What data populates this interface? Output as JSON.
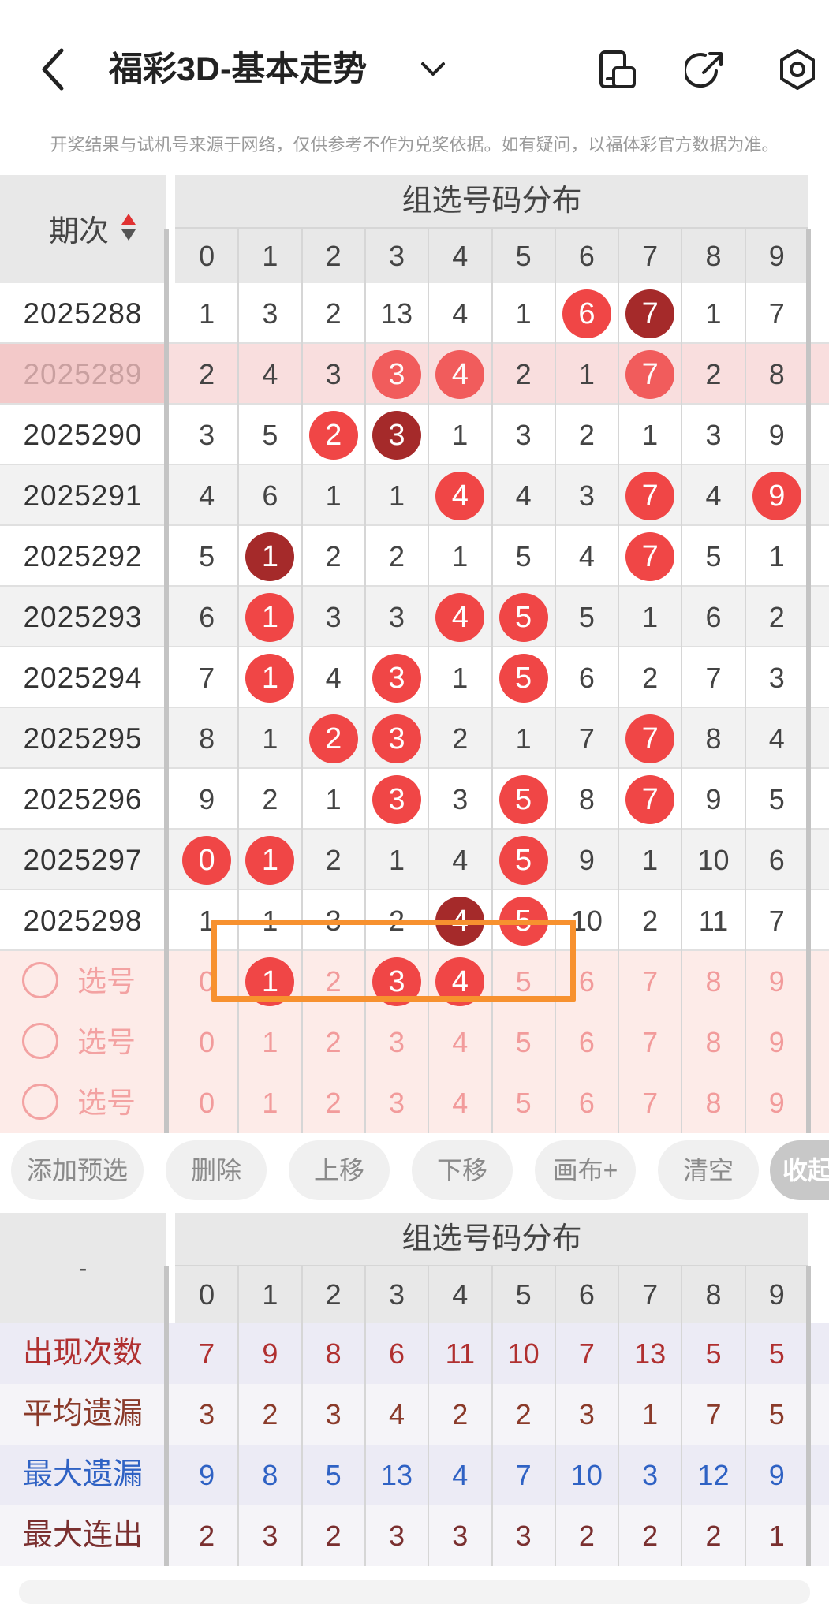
{
  "header": {
    "title": "福彩3D-基本走势",
    "notice": "开奖结果与试机号来源于网络，仅供参考不作为兑奖依据。如有疑问，以福体彩官方数据为准。"
  },
  "table": {
    "issue_header": "期次",
    "section_title": "组选号码分布",
    "digits": [
      "0",
      "1",
      "2",
      "3",
      "4",
      "5",
      "6",
      "7",
      "8",
      "9"
    ],
    "rows": [
      {
        "issue": "2025288",
        "cells": [
          "1",
          "3",
          "2",
          "13",
          "4",
          "1",
          "6",
          "7",
          "1",
          "7"
        ],
        "balls": {
          "6": "red",
          "7": "dark"
        }
      },
      {
        "issue": "2025289",
        "cells": [
          "2",
          "4",
          "3",
          "3",
          "4",
          "2",
          "1",
          "7",
          "2",
          "8"
        ],
        "balls": {
          "3": "red",
          "4": "red",
          "7": "red"
        }
      },
      {
        "issue": "2025290",
        "cells": [
          "3",
          "5",
          "2",
          "3",
          "1",
          "3",
          "2",
          "1",
          "3",
          "9"
        ],
        "balls": {
          "2": "red",
          "3": "dark"
        }
      },
      {
        "issue": "2025291",
        "cells": [
          "4",
          "6",
          "1",
          "1",
          "4",
          "4",
          "3",
          "7",
          "4",
          "9"
        ],
        "balls": {
          "4": "red",
          "7": "red",
          "9": "red"
        }
      },
      {
        "issue": "2025292",
        "cells": [
          "5",
          "1",
          "2",
          "2",
          "1",
          "5",
          "4",
          "7",
          "5",
          "1"
        ],
        "balls": {
          "1": "dark",
          "7": "red"
        }
      },
      {
        "issue": "2025293",
        "cells": [
          "6",
          "1",
          "3",
          "3",
          "4",
          "5",
          "5",
          "1",
          "6",
          "2"
        ],
        "balls": {
          "1": "red",
          "4": "red",
          "5": "red"
        }
      },
      {
        "issue": "2025294",
        "cells": [
          "7",
          "1",
          "4",
          "3",
          "1",
          "5",
          "6",
          "2",
          "7",
          "3"
        ],
        "balls": {
          "1": "red",
          "3": "red",
          "5": "red"
        }
      },
      {
        "issue": "2025295",
        "cells": [
          "8",
          "1",
          "2",
          "3",
          "2",
          "1",
          "7",
          "7",
          "8",
          "4"
        ],
        "balls": {
          "2": "red",
          "3": "red",
          "7": "red"
        }
      },
      {
        "issue": "2025296",
        "cells": [
          "9",
          "2",
          "1",
          "3",
          "3",
          "5",
          "8",
          "7",
          "9",
          "5"
        ],
        "balls": {
          "3": "red",
          "5": "red",
          "7": "red"
        }
      },
      {
        "issue": "2025297",
        "cells": [
          "0",
          "1",
          "2",
          "1",
          "4",
          "5",
          "9",
          "1",
          "10",
          "6"
        ],
        "balls": {
          "0": "red",
          "1": "red",
          "5": "red"
        }
      },
      {
        "issue": "2025298",
        "cells": [
          "1",
          "1",
          "3",
          "2",
          "4",
          "5",
          "10",
          "2",
          "11",
          "7"
        ],
        "balls": {
          "4": "dark",
          "5": "red"
        }
      }
    ],
    "picks": [
      {
        "label": "选号",
        "selected": [
          "1",
          "3",
          "4"
        ]
      },
      {
        "label": "选号",
        "selected": []
      },
      {
        "label": "选号",
        "selected": []
      }
    ]
  },
  "buttons": [
    "添加预选",
    "删除",
    "上移",
    "下移",
    "画布+",
    "清空",
    "收起"
  ],
  "stats": {
    "corner": "-",
    "section_title": "组选号码分布",
    "rows": [
      {
        "label": "出现次数",
        "color": "#b03030",
        "values": [
          "7",
          "9",
          "8",
          "6",
          "11",
          "10",
          "7",
          "13",
          "5",
          "5"
        ]
      },
      {
        "label": "平均遗漏",
        "color": "#8a3a2a",
        "values": [
          "3",
          "2",
          "3",
          "4",
          "2",
          "2",
          "3",
          "1",
          "7",
          "5"
        ]
      },
      {
        "label": "最大遗漏",
        "color": "#2f62c4",
        "values": [
          "9",
          "8",
          "5",
          "13",
          "4",
          "7",
          "10",
          "3",
          "12",
          "9"
        ]
      },
      {
        "label": "最大连出",
        "color": "#7a2f2f",
        "values": [
          "2",
          "3",
          "2",
          "3",
          "3",
          "3",
          "2",
          "2",
          "2",
          "1"
        ]
      }
    ]
  },
  "colors": {
    "ball_red": "#f04646",
    "ball_dark": "#a52a2a",
    "highlight_box": "#f7912f",
    "pick_bg": "#fdebe8",
    "highlight_row": "#f9dede"
  }
}
